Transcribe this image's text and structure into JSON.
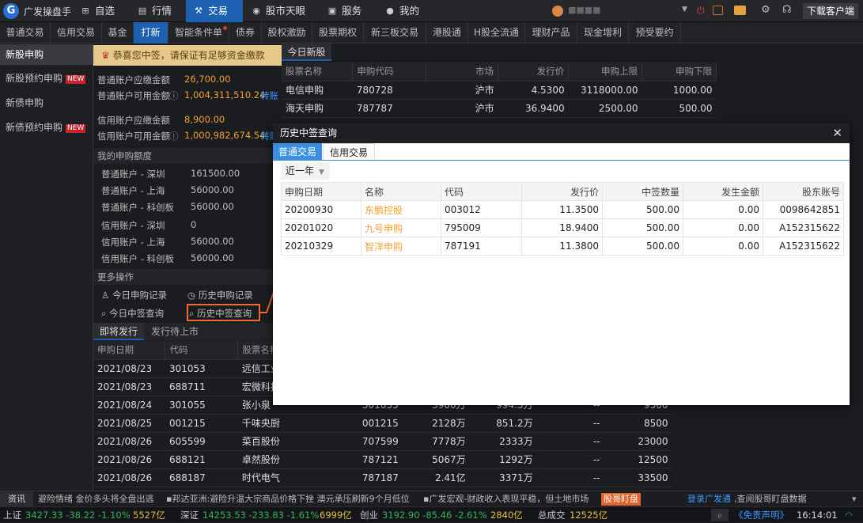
{
  "app": {
    "name": "广发操盘手",
    "download": "下载客户端",
    "user_masked": "■■■■"
  },
  "nav": [
    {
      "label": "自选",
      "icon": "plus-square-icon"
    },
    {
      "label": "行情",
      "icon": "chart-icon"
    },
    {
      "label": "交易",
      "icon": "gavel-icon",
      "active": true
    },
    {
      "label": "股市天眼",
      "icon": "eye-icon"
    },
    {
      "label": "服务",
      "icon": "briefcase-icon"
    },
    {
      "label": "我的",
      "icon": "person-icon"
    }
  ],
  "subnav": [
    "普通交易",
    "信用交易",
    "基金",
    "打新",
    "智能条件单",
    "债券",
    "股权激励",
    "股票期权",
    "新三板交易",
    "港股通",
    "H股全流通",
    "理财产品",
    "现金增利",
    "预受要约"
  ],
  "sidebar": [
    {
      "label": "新股申购",
      "active": true
    },
    {
      "label": "新股预约申购",
      "badge": "NEW"
    },
    {
      "label": "新债申购"
    },
    {
      "label": "新债预约申购",
      "badge": "NEW"
    }
  ],
  "notice": "恭喜您中签，请保证有足够资金缴款",
  "funds": {
    "normal_due_label": "普通账户应缴金额",
    "normal_due": "26,700.00",
    "normal_avail_label": "普通账户可用金额",
    "normal_avail": "1,004,311,510.24",
    "credit_due_label": "信用账户应缴金额",
    "credit_due": "8,900.00",
    "credit_avail_label": "信用账户可用金额",
    "credit_avail": "1,000,982,674.54",
    "transfer": "转账"
  },
  "quota": {
    "title": "我的申购额度",
    "rows": [
      {
        "label": "普通账户 - 深圳",
        "value": "161500.00"
      },
      {
        "label": "普通账户 - 上海",
        "value": "56000.00"
      },
      {
        "label": "普通账户 - 科创板",
        "value": "56000.00"
      },
      {
        "label": "信用账户 - 深圳",
        "value": "0"
      },
      {
        "label": "信用账户 - 上海",
        "value": "56000.00"
      },
      {
        "label": "信用账户 - 科创板",
        "value": "56000.00"
      }
    ]
  },
  "more": {
    "title": "更多操作",
    "today_apply": "今日申购记录",
    "history_apply": "历史申购记录",
    "today_win": "今日中签查询",
    "history_win": "历史中签查询"
  },
  "today_new": {
    "tab": "今日新股",
    "headers": [
      "股票名称",
      "申购代码",
      "市场",
      "发行价",
      "申购上限",
      "申购下限"
    ],
    "rows": [
      [
        "电信申购",
        "780728",
        "沪市",
        "4.5300",
        "3118000.00",
        "1000.00"
      ],
      [
        "海天申购",
        "787787",
        "沪市",
        "36.9400",
        "2500.00",
        "500.00"
      ]
    ]
  },
  "upcoming": {
    "tabs": [
      "即将发行",
      "发行待上市"
    ],
    "headers": [
      "申购日期",
      "代码",
      "股票名称"
    ],
    "rows": [
      [
        "2021/08/23",
        "301053",
        "远信工业",
        "",
        "",
        "",
        "",
        ""
      ],
      [
        "2021/08/23",
        "688711",
        "宏微科技",
        "",
        "",
        "",
        "",
        ""
      ],
      [
        "2021/08/24",
        "301055",
        "张小泉",
        "301055",
        "3900万",
        "994.5万",
        "--",
        "9500"
      ],
      [
        "2021/08/25",
        "001215",
        "千味央厨",
        "001215",
        "2128万",
        "851.2万",
        "--",
        "8500"
      ],
      [
        "2021/08/26",
        "605599",
        "菜百股份",
        "707599",
        "7778万",
        "2333万",
        "--",
        "23000"
      ],
      [
        "2021/08/26",
        "688121",
        "卓然股份",
        "787121",
        "5067万",
        "1292万",
        "--",
        "12500"
      ],
      [
        "2021/08/26",
        "688187",
        "时代电气",
        "787187",
        "2.41亿",
        "3371万",
        "--",
        "33500"
      ]
    ]
  },
  "modal": {
    "title": "历史中签查询",
    "tabs": [
      "普通交易",
      "信用交易"
    ],
    "period": "近一年",
    "headers": [
      "申购日期",
      "名称",
      "代码",
      "发行价",
      "中签数量",
      "发生金额",
      "股东账号"
    ],
    "rows": [
      [
        "20200930",
        "东鹏控股",
        "003012",
        "11.3500",
        "500.00",
        "0.00",
        "0098642851"
      ],
      [
        "20201020",
        "九号申购",
        "795009",
        "18.9400",
        "500.00",
        "0.00",
        "A152315622"
      ],
      [
        "20210329",
        "智洋申购",
        "787191",
        "11.3800",
        "500.00",
        "0.00",
        "A152315622"
      ]
    ]
  },
  "ticker": {
    "label": "资讯",
    "items": [
      "避险情绪 金价多头将全盘出逃",
      "▪邦达亚洲:避险升温大宗商品价格下挫 澳元承压刷新9个月低位",
      "▪广发宏观-财政收入表现平稳，但土地市场"
    ],
    "badge": "股哥盯盘",
    "login": "登录广发通",
    "login_tail": ",查阅股哥盯盘数据"
  },
  "status": {
    "sh_label": "上证",
    "sh": "3427.33 -38.22 -1.10%",
    "sh_amt": "5527亿",
    "sz_label": "深证",
    "sz": "14253.53 -233.83 -1.61%",
    "sz_amt": "6999亿",
    "cy_label": "创业",
    "cy": "3192.90 -85.46 -2.61%",
    "cy_amt": "2840亿",
    "total_label": "总成交",
    "total": "12525亿",
    "disclaimer": "《免责声明》",
    "time": "16:14:01"
  }
}
